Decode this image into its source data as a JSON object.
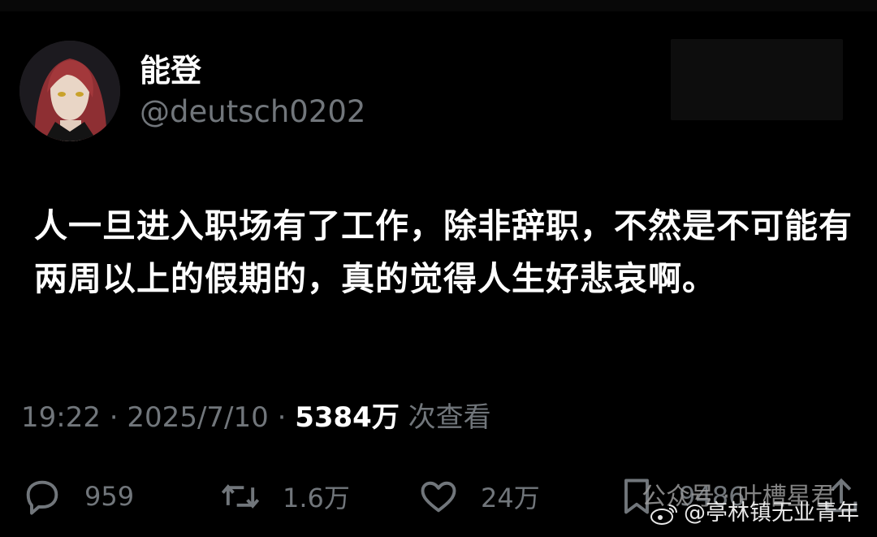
{
  "author": {
    "display_name": "能登",
    "handle": "@deutsch0202"
  },
  "tweet": {
    "text": "人一旦进入职场有了工作，除非辞职，不然是不可能有两周以上的假期的，真的觉得人生好悲哀啊。"
  },
  "meta": {
    "time": "19:22",
    "separator": "·",
    "date": "2025/7/10",
    "views_count": "5384万",
    "views_label": "次查看"
  },
  "actions": {
    "reply_count": "959",
    "retweet_count": "1.6万",
    "like_count": "24万",
    "bookmark_count": "9486"
  },
  "watermark": {
    "overlay_text": "公众号 · 叶槽星君",
    "weibo_text": "@亭林镇无业青年"
  },
  "colors": {
    "background": "#000000",
    "primary_text": "#ffffff",
    "secondary_text": "#71767b"
  }
}
